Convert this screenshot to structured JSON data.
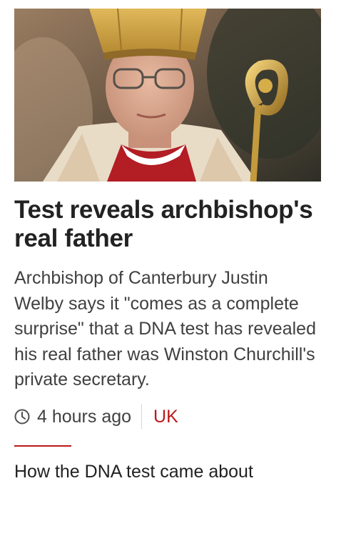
{
  "story": {
    "image_alt": "Archbishop of Canterbury Justin Welby",
    "headline": "Test reveals archbishop's real father",
    "summary": "Archbishop of Canterbury Justin Welby says it \"comes as a complete surprise\" that a DNA test has revealed his real father was Winston Churchill's private secretary.",
    "meta": {
      "time_icon": "clock-icon",
      "time": "4 hours ago",
      "section": "UK"
    },
    "related_link": "How the DNA test came about"
  },
  "colors": {
    "accent": "#bb1919",
    "text": "#222222",
    "muted": "#404040"
  }
}
